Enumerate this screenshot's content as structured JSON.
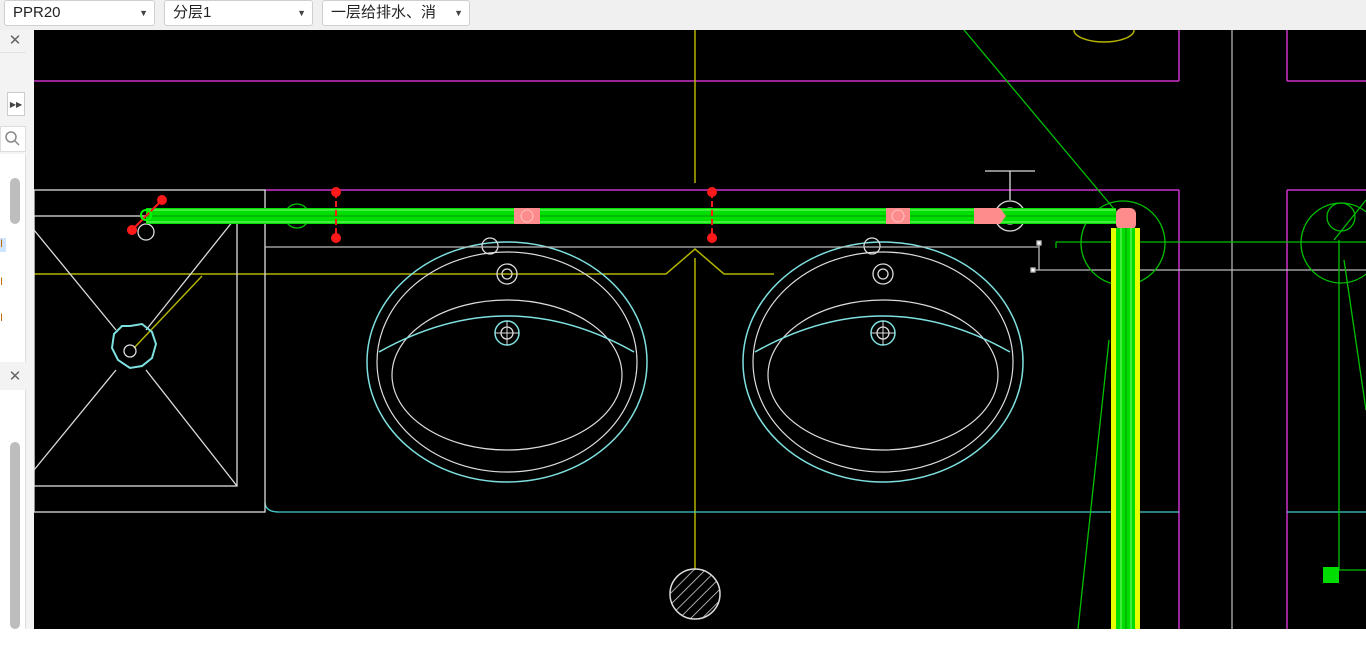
{
  "toolbar": {
    "spec_select": {
      "value": "PPR20"
    },
    "floor_select": {
      "value": "分层1"
    },
    "layer_select": {
      "value": "一层给排水、消"
    }
  },
  "icons": {
    "close": "close-icon",
    "expand": "double-chevron-right-icon",
    "search": "search-icon",
    "dropdown": "caret-down-icon"
  },
  "colors": {
    "canvas_background": "#000000",
    "pipe": "#00dd00",
    "pipe_highlight": "#e6ff00",
    "wall_line": "#cc33cc",
    "fixture_outline": "#7fe0e0",
    "fixture_white": "#dddddd",
    "axis_line": "#b3b300",
    "fitting": "#ff8c8c",
    "valve_marker": "#ff1a1a"
  }
}
